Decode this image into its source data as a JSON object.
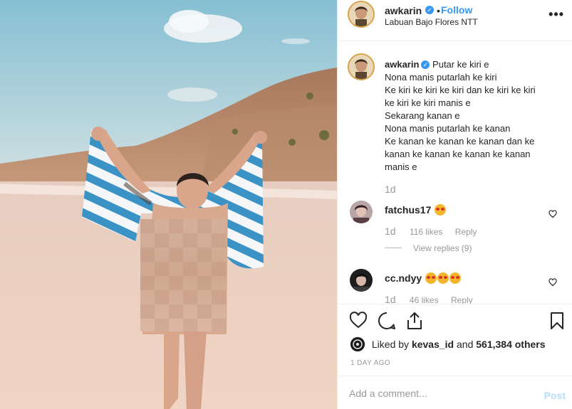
{
  "post": {
    "username": "awkarin",
    "verified_icon": "verified-badge-icon",
    "follow_label": "Follow",
    "separator": "•",
    "location": "Labuan Bajo Flores NTT",
    "more_label": "•••"
  },
  "caption": {
    "username": "awkarin",
    "lines": [
      "Putar ke kiri e",
      "Nona manis putarlah ke kiri",
      "Ke kiri ke kiri ke kiri dan ke kiri ke kiri",
      "ke kiri ke kiri manis e",
      "Sekarang kanan e",
      "Nona manis putarlah ke kanan",
      "Ke kanan ke kanan ke kanan dan ke",
      "kanan ke kanan ke kanan ke kanan",
      "manis e"
    ],
    "time": "1d"
  },
  "comments": [
    {
      "username": "fatchus17",
      "emoji_count": 1,
      "time": "1d",
      "likes": "116 likes",
      "reply_label": "Reply",
      "view_replies": "View replies (9)"
    },
    {
      "username": "cc.ndyy",
      "emoji_count": 3,
      "time": "1d",
      "likes": "46 likes",
      "reply_label": "Reply"
    }
  ],
  "actions": {
    "like_icon": "heart-icon",
    "comment_icon": "comment-icon",
    "share_icon": "share-icon",
    "save_icon": "bookmark-icon"
  },
  "likes": {
    "prefix": "Liked by",
    "user": "kevas_id",
    "and": "and",
    "others": "561,384 others"
  },
  "post_date": "1 DAY AGO",
  "add_comment": {
    "placeholder": "Add a comment...",
    "post_label": "Post"
  },
  "colors": {
    "accent": "#3897f0",
    "post_disabled": "#b2dffc",
    "meta_gray": "#999999"
  }
}
